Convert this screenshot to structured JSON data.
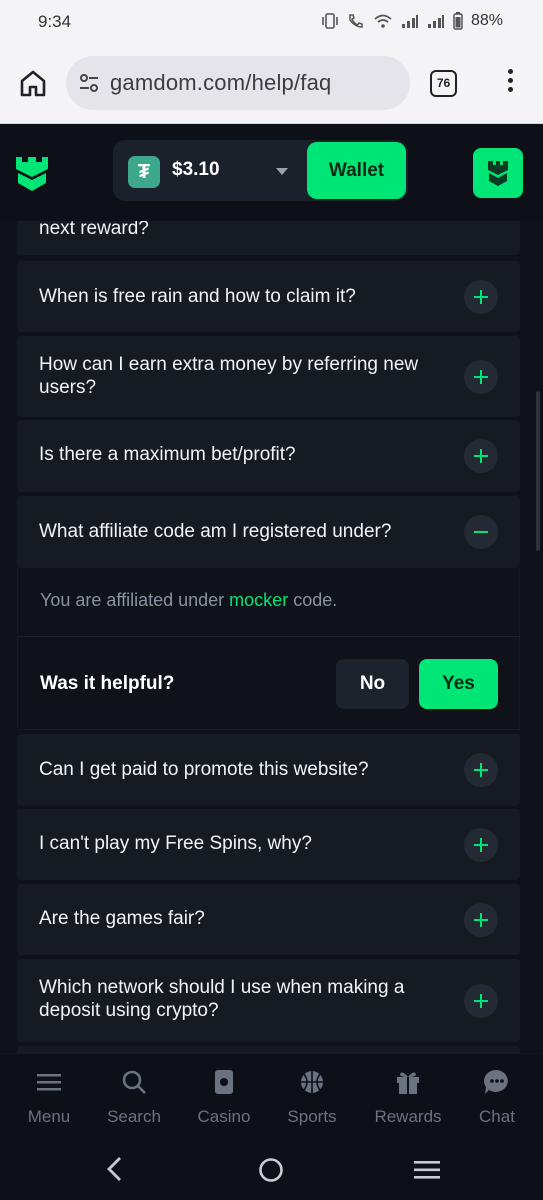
{
  "status_bar": {
    "time": "9:34",
    "battery": "88%"
  },
  "browser": {
    "url": "gamdom.com/help/faq",
    "tab_count": "76"
  },
  "header": {
    "balance": "$3.10",
    "currency_symbol": "₮",
    "wallet_label": "Wallet"
  },
  "faq": {
    "partial_question": "next reward?",
    "items_before": [
      "When is free rain and how to claim it?",
      "How can I earn extra money by referring new users?",
      "Is there a maximum bet/profit?"
    ],
    "expanded": {
      "question": "What affiliate code am I registered under?",
      "answer_prefix": "You are affiliated under",
      "answer_code": "mocker",
      "answer_suffix": "code.",
      "helpful_label": "Was it helpful?",
      "no_label": "No",
      "yes_label": "Yes"
    },
    "items_after": [
      "Can I get paid to promote this website?",
      "I can't play my Free Spins, why?",
      "Are the games fair?",
      "Which network should I use when making a deposit using crypto?"
    ]
  },
  "bottom_nav": {
    "items": [
      {
        "label": "Menu",
        "icon": "menu-icon"
      },
      {
        "label": "Search",
        "icon": "search-icon"
      },
      {
        "label": "Casino",
        "icon": "casino-icon"
      },
      {
        "label": "Sports",
        "icon": "basketball-icon"
      },
      {
        "label": "Rewards",
        "icon": "gift-icon"
      },
      {
        "label": "Chat",
        "icon": "chat-icon"
      }
    ]
  },
  "colors": {
    "accent": "#00e676",
    "background": "#0f1218",
    "card": "#161b22"
  }
}
